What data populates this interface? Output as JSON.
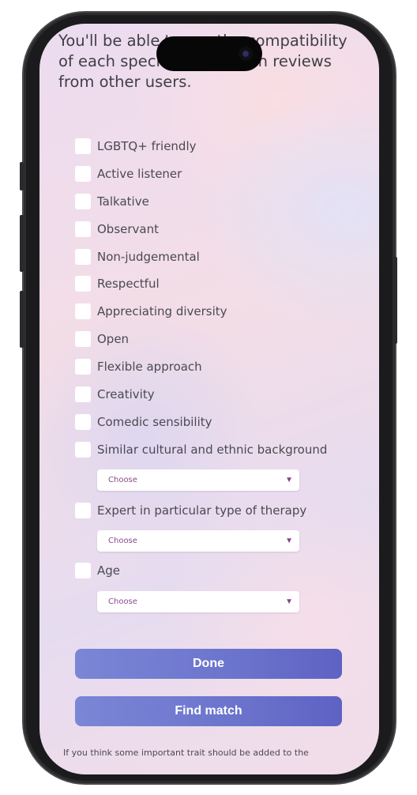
{
  "intro": {
    "text": "You'll be able to see the compatibility of each specialist based on reviews from other users."
  },
  "traits": [
    {
      "label": "LGBTQ+ friendly"
    },
    {
      "label": "Active listener"
    },
    {
      "label": "Talkative"
    },
    {
      "label": "Observant"
    },
    {
      "label": "Non-judgemental"
    },
    {
      "label": "Respectful"
    },
    {
      "label": "Appreciating diversity"
    },
    {
      "label": "Open"
    },
    {
      "label": "Flexible approach"
    },
    {
      "label": "Creativity"
    },
    {
      "label": "Comedic sensibility"
    },
    {
      "label": "Similar cultural and ethnic background"
    },
    {
      "label": "Expert in particular type of therapy"
    },
    {
      "label": "Age"
    }
  ],
  "selects": [
    {
      "value": "Choose"
    },
    {
      "value": "Choose"
    },
    {
      "value": "Choose"
    }
  ],
  "buttons": {
    "done": "Done",
    "find_match": "Find match"
  },
  "footnote": "If you think some important trait should be added to the",
  "icons": {
    "dropdown_arrow": "▼",
    "camera": "camera-icon"
  },
  "colors": {
    "button_start": "#7b86d6",
    "button_end": "#5e62c4",
    "select_text": "#8a4a8e"
  }
}
